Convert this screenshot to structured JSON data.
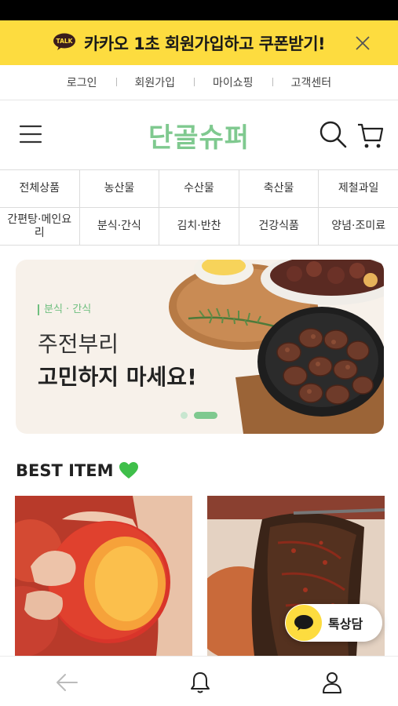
{
  "kakao_banner": {
    "badge": "TALK",
    "text": "카카오 1초 회원가입하고 쿠폰받기!",
    "colors": {
      "background": "#fddc3f"
    }
  },
  "top_nav": {
    "items": [
      "로그인",
      "회원가입",
      "마이쇼핑",
      "고객센터"
    ]
  },
  "header": {
    "logo": "단골슈퍼",
    "brand_color": "#7fc98f",
    "icons": [
      "menu-icon",
      "search-icon",
      "cart-icon"
    ]
  },
  "categories": {
    "row1": [
      "전체상품",
      "농산물",
      "수산물",
      "축산물",
      "제철과일"
    ],
    "row2": [
      "간편탕·메인요리",
      "분식·간식",
      "김치·반찬",
      "건강식품",
      "양념·조미료"
    ]
  },
  "hero": {
    "tag": "분식 · 간식",
    "line1": "주전부리",
    "line2": "고민하지 마세요!",
    "slides_total": 2,
    "active_slide": 2
  },
  "best": {
    "title": "BEST ITEM",
    "emoji": "💚",
    "products": [
      {
        "image": "peach-image"
      },
      {
        "image": "seasoned-perilla-leaves-image"
      }
    ]
  },
  "kakao_chat": {
    "label": "톡상담"
  },
  "bottom_nav": {
    "icons": [
      "back-arrow-icon",
      "bell-icon",
      "user-icon"
    ]
  }
}
